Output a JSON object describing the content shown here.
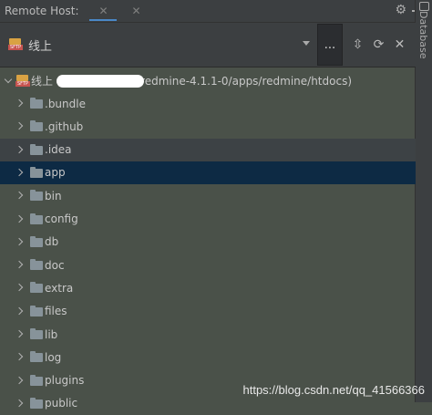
{
  "panel": {
    "title": "Remote Host:"
  },
  "toolbar": {
    "server_name": "线上",
    "more_label": "..."
  },
  "icons": {
    "close": "close-icon",
    "settings": "gear-icon",
    "minimize": "minimize-icon",
    "collapse": "collapse-icon",
    "refresh": "refresh-icon",
    "server": "sftp-server-icon",
    "folder": "folder-icon"
  },
  "side_strip": {
    "label": "Database"
  },
  "tree": {
    "root_prefix": "线上 (",
    "root_path": "/redmine-4.1.1-0/apps/redmine/htdocs)",
    "folders": [
      ".bundle",
      ".github",
      ".idea",
      "app",
      "bin",
      "config",
      "db",
      "doc",
      "extra",
      "files",
      "lib",
      "log",
      "plugins",
      "public"
    ]
  },
  "watermark": "https://blog.csdn.net/qq_41566366",
  "colors": {
    "selection": "#0d2a44",
    "hover": "#3d4245",
    "background": "#4a5149",
    "tab_underline": "#4a88c7"
  }
}
